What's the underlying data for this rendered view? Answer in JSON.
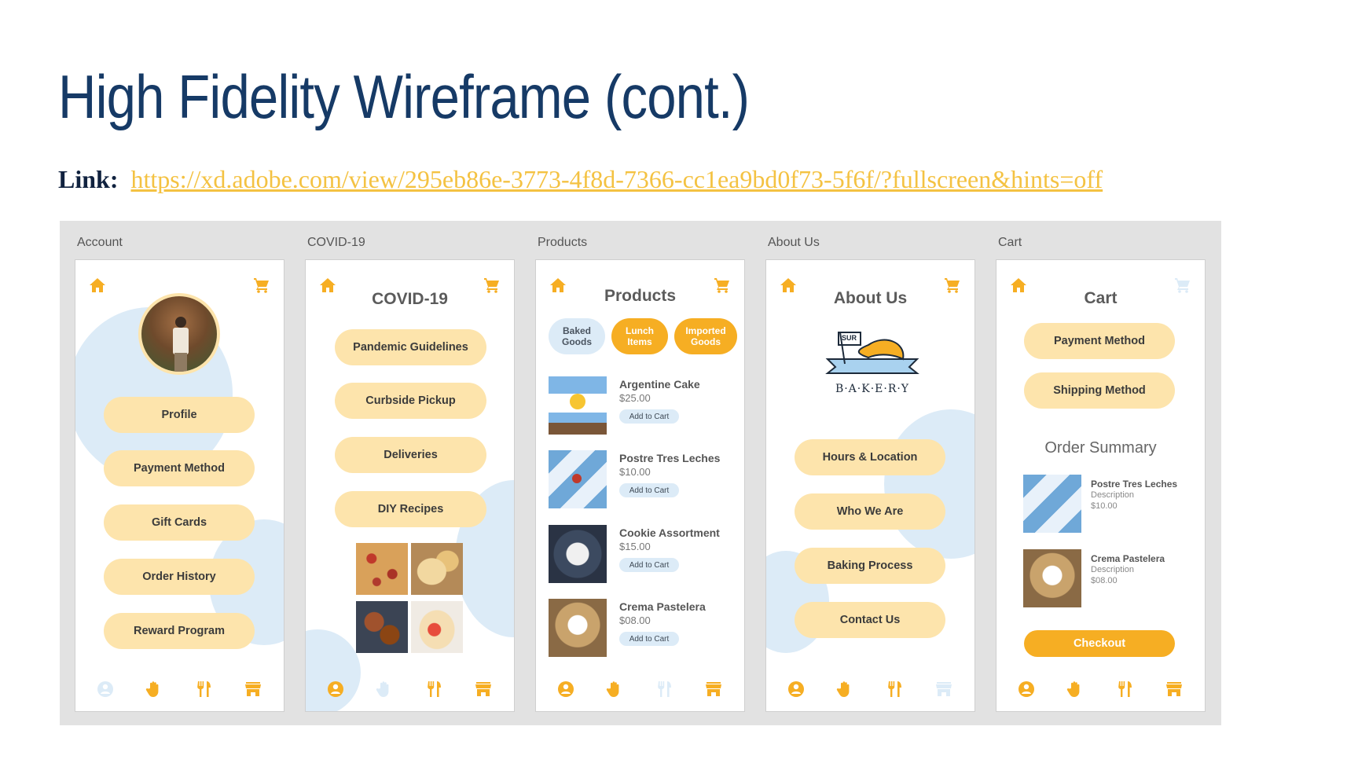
{
  "slide": {
    "title": "High Fidelity Wireframe (cont.)",
    "link_label": "Link:",
    "link_url": "https://xd.adobe.com/view/295eb86e-3773-4f8d-7366-cc1ea9bd0f73-5f6f/?fullscreen&hints=off"
  },
  "colors": {
    "accent": "#f6ae23",
    "pill": "#fde4ac",
    "blob": "#dcebf7",
    "title": "#163a66",
    "link": "#f4c242"
  },
  "screens": {
    "account": {
      "caption": "Account",
      "menu": [
        "Profile",
        "Payment Method",
        "Gift Cards",
        "Order History",
        "Reward Program"
      ]
    },
    "covid": {
      "caption": "COVID-19",
      "title": "COVID-19",
      "menu": [
        "Pandemic Guidelines",
        "Curbside Pickup",
        "Deliveries",
        "DIY Recipes"
      ]
    },
    "products": {
      "caption": "Products",
      "title": "Products",
      "filters": [
        "Baked\nGoods",
        "Lunch\nItems",
        "Imported\nGoods"
      ],
      "items": [
        {
          "name": "Argentine Cake",
          "price": "$25.00",
          "button": "Add to Cart"
        },
        {
          "name": "Postre Tres Leches",
          "price": "$10.00",
          "button": "Add to Cart"
        },
        {
          "name": "Cookie Assortment",
          "price": "$15.00",
          "button": "Add to Cart"
        },
        {
          "name": "Crema Pastelera",
          "price": "$08.00",
          "button": "Add to Cart"
        }
      ]
    },
    "about": {
      "caption": "About Us",
      "title": "About Us",
      "logo_text": "SUR",
      "logo_word": "B·A·K·E·R·Y",
      "menu": [
        "Hours & Location",
        "Who We Are",
        "Baking Process",
        "Contact Us"
      ]
    },
    "cart": {
      "caption": "Cart",
      "title": "Cart",
      "menu": [
        "Payment Method",
        "Shipping Method"
      ],
      "summary_title": "Order Summary",
      "items": [
        {
          "name": "Postre Tres Leches",
          "desc": "Description",
          "price": "$10.00"
        },
        {
          "name": "Crema Pastelera",
          "desc": "Description",
          "price": "$08.00"
        }
      ],
      "checkout": "Checkout"
    }
  },
  "icons": {
    "header_left": "home-icon",
    "header_right": "cart-icon",
    "tabs": [
      "account-icon",
      "hand-icon",
      "fork-knife-icon",
      "store-icon"
    ]
  }
}
